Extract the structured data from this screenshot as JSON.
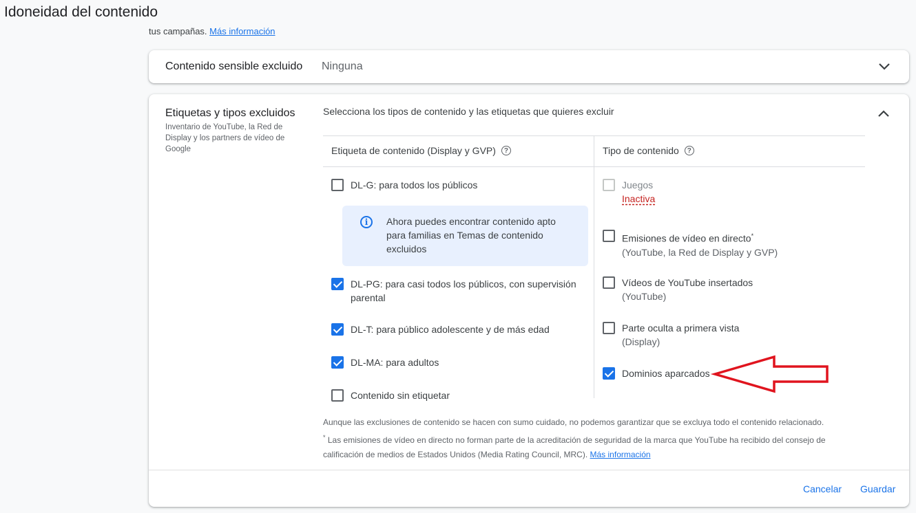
{
  "page": {
    "title": "Idoneidad del contenido"
  },
  "intro": {
    "text": "tus campañas.",
    "link": "Más información"
  },
  "sensitive": {
    "label": "Contenido sensible excluido",
    "value": "Ninguna",
    "icon": "chevron-down-icon"
  },
  "excluded": {
    "title": "Etiquetas y tipos excluidos",
    "subtitle": "Inventario de YouTube, la Red de Display y los partners de vídeo de Google",
    "description": "Selecciona los tipos de contenido y las etiquetas que quieres excluir",
    "icon": "chevron-up-icon",
    "labels_column": {
      "header": "Etiqueta de contenido (Display y GVP)",
      "items": [
        {
          "label": "DL-G: para todos los públicos",
          "checked": false
        },
        {
          "label": "DL-PG: para casi todos los públicos, con supervisión parental",
          "checked": true
        },
        {
          "label": "DL-T: para público adolescente y de más edad",
          "checked": true
        },
        {
          "label": "DL-MA: para adultos",
          "checked": true
        },
        {
          "label": "Contenido sin etiquetar",
          "checked": false
        }
      ],
      "info": "Ahora puedes encontrar contenido apto para familias en Temas de contenido excluidos"
    },
    "types_column": {
      "header": "Tipo de contenido",
      "items": [
        {
          "label": "Juegos",
          "status": "Inactiva",
          "checked": false,
          "disabled": true
        },
        {
          "label": "Emisiones de vídeo en directo",
          "sub": "(YouTube, la Red de Display y GVP)",
          "checked": false
        },
        {
          "label": "Vídeos de YouTube insertados",
          "sub": "(YouTube)",
          "checked": false
        },
        {
          "label": "Parte oculta a primera vista",
          "sub": "(Display)",
          "checked": false
        },
        {
          "label": "Dominios aparcados",
          "checked": true
        }
      ]
    },
    "note1": "Aunque las exclusiones de contenido se hacen con sumo cuidado, no podemos garantizar que se excluya todo el contenido relacionado.",
    "note2": "Las emisiones de vídeo en directo no forman parte de la acreditación de seguridad de la marca que YouTube ha recibido del consejo de calificación de medios de Estados Unidos (Media Rating Council, MRC).",
    "note2_link": "Más información",
    "cancel": "Cancelar",
    "save": "Guardar"
  },
  "annotation": {
    "color": "#e0141e"
  }
}
